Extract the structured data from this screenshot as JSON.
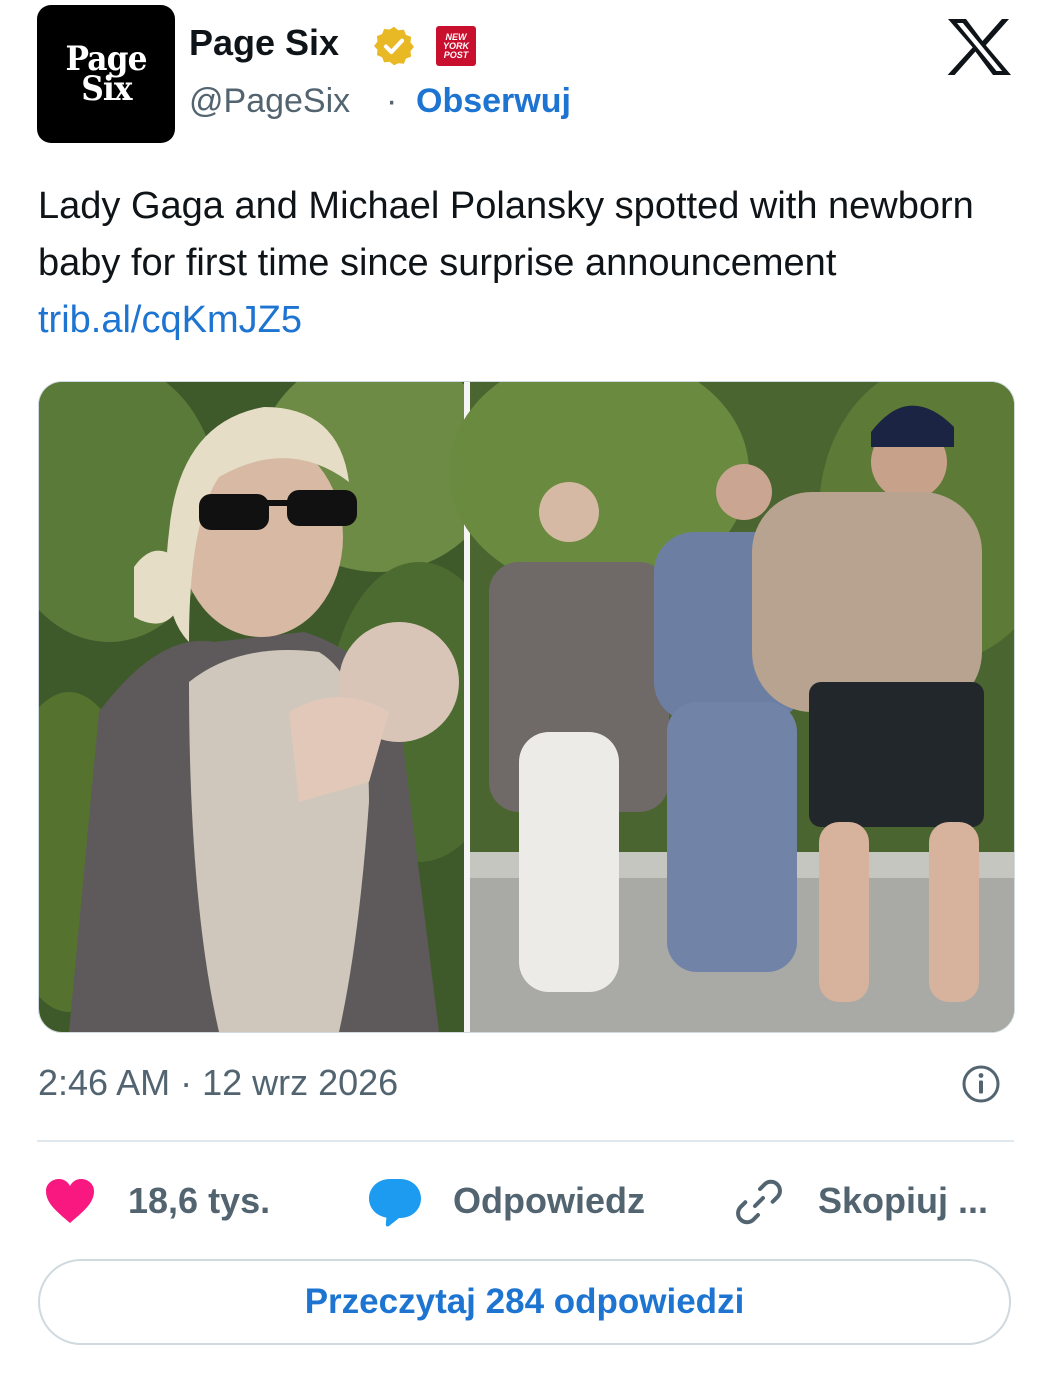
{
  "author": {
    "avatar_line1": "Page",
    "avatar_line2": "Six",
    "name": "Page Six",
    "handle": "@PageSix",
    "separator": "·",
    "follow_label": "Obserwuj",
    "affiliate_badge": [
      "NEW",
      "YORK",
      "POST"
    ]
  },
  "tweet": {
    "text": "Lady Gaga and Michael Polansky spotted with newborn baby for first time since surprise announcement ",
    "link": "trib.al/cqKmJZ5"
  },
  "meta": {
    "timestamp": "2:46 AM · 12 wrz 2026"
  },
  "actions": {
    "likes_count": "18,6 tys.",
    "reply_label": "Odpowiedz",
    "copy_label": "Skopiuj ..."
  },
  "read_replies_label": "Przeczytaj 284 odpowiedzi",
  "colors": {
    "accent_blue": "#1d74d1",
    "heart": "#f91880",
    "bubble": "#1d9bf0",
    "verified_gold": "#e8b825",
    "nypost_red": "#c8102e"
  },
  "icons": [
    "verified-badge-icon",
    "x-logo-icon",
    "info-icon",
    "heart-icon",
    "reply-bubble-icon",
    "link-icon"
  ]
}
